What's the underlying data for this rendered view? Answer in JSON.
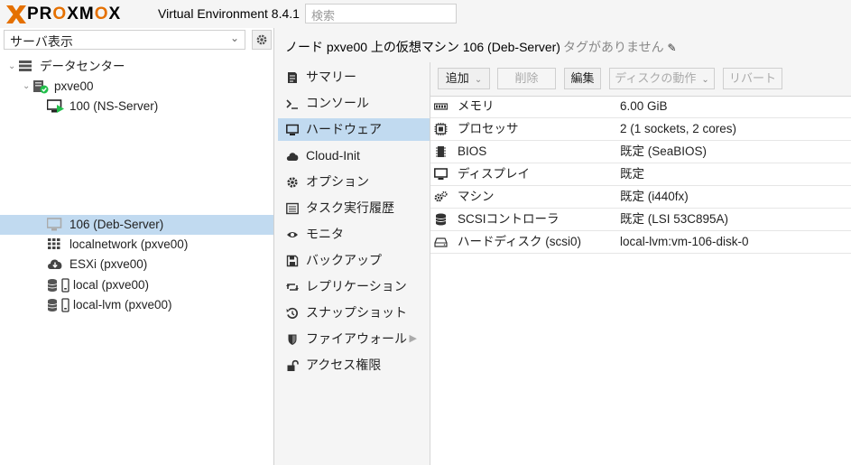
{
  "header": {
    "logo_text": "PROXMOX",
    "product": "Virtual Environment 8.4.1",
    "search_placeholder": "検索"
  },
  "left_panel": {
    "view_select": "サーバ表示",
    "tree": [
      {
        "label": "データセンター",
        "icon": "datacenter-icon"
      },
      {
        "label": "pxve00",
        "icon": "node-online-icon"
      },
      {
        "label": "100 (NS-Server)",
        "icon": "vm-running-icon"
      },
      {
        "label": "106 (Deb-Server)",
        "icon": "vm-stopped-icon",
        "selected": true
      },
      {
        "label": "localnetwork (pxve00)",
        "icon": "network-grid-icon"
      },
      {
        "label": "ESXi (pxve00)",
        "icon": "cloud-download-icon"
      },
      {
        "label": "local (pxve00)",
        "icon": "storage-icon"
      },
      {
        "label": "local-lvm (pxve00)",
        "icon": "storage-icon"
      }
    ]
  },
  "content": {
    "title": "ノード pxve00 上の仮想マシン 106 (Deb-Server)",
    "tags": "タグがありません"
  },
  "nav": [
    {
      "label": "サマリー",
      "icon": "summary-icon"
    },
    {
      "label": "コンソール",
      "icon": "console-icon"
    },
    {
      "label": "ハードウェア",
      "icon": "monitor-icon",
      "active": true
    },
    {
      "label": "Cloud-Init",
      "icon": "cloud-icon"
    },
    {
      "label": "オプション",
      "icon": "gear-icon"
    },
    {
      "label": "タスク実行履歴",
      "icon": "list-icon"
    },
    {
      "label": "モニタ",
      "icon": "eye-icon"
    },
    {
      "label": "バックアップ",
      "icon": "floppy-icon"
    },
    {
      "label": "レプリケーション",
      "icon": "retweet-icon"
    },
    {
      "label": "スナップショット",
      "icon": "history-icon"
    },
    {
      "label": "ファイアウォール",
      "icon": "shield-icon"
    },
    {
      "label": "アクセス権限",
      "icon": "unlock-icon"
    }
  ],
  "toolbar": {
    "add": "追加",
    "remove": "削除",
    "edit": "編集",
    "disk_action": "ディスクの動作",
    "revert": "リバート"
  },
  "hardware": [
    {
      "name": "メモリ",
      "value": "6.00 GiB",
      "icon": "memory-icon"
    },
    {
      "name": "プロセッサ",
      "value": "2 (1 sockets, 2 cores)",
      "icon": "cpu-icon"
    },
    {
      "name": "BIOS",
      "value": "既定 (SeaBIOS)",
      "icon": "chip-icon"
    },
    {
      "name": "ディスプレイ",
      "value": "既定",
      "icon": "display-icon"
    },
    {
      "name": "マシン",
      "value": "既定 (i440fx)",
      "icon": "cogs-icon"
    },
    {
      "name": "SCSIコントローラ",
      "value": "既定 (LSI 53C895A)",
      "icon": "database-icon"
    },
    {
      "name": "ハードディスク (scsi0)",
      "value": "local-lvm:vm-106-disk-0",
      "icon": "hdd-icon"
    }
  ],
  "colors": {
    "accent": "#e57000",
    "selection": "#c1daf0",
    "running": "#21bf4b"
  }
}
